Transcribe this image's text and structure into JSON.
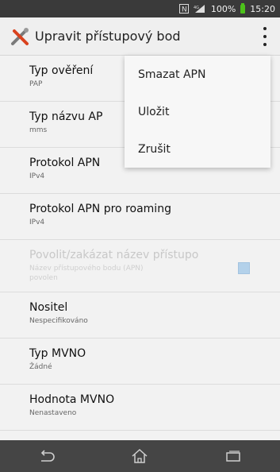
{
  "status_bar": {
    "nfc": "N",
    "signal": "4G",
    "battery": "100%",
    "time": "15:20"
  },
  "action_bar": {
    "title": "Upravit přístupový bod"
  },
  "settings": [
    {
      "title": "Typ ověření",
      "subtitle": "PAP"
    },
    {
      "title": "Typ názvu AP",
      "subtitle": "mms"
    },
    {
      "title": "Protokol APN",
      "subtitle": "IPv4"
    },
    {
      "title": "Protokol APN pro roaming",
      "subtitle": "IPv4"
    },
    {
      "title": "Povolit/zakázat název přístupo",
      "subtitle": "Název přístupového bodu (APN) povolen"
    },
    {
      "title": "Nositel",
      "subtitle": "Nespecifikováno"
    },
    {
      "title": "Typ MVNO",
      "subtitle": "Žádné"
    },
    {
      "title": "Hodnota MVNO",
      "subtitle": "Nenastaveno"
    }
  ],
  "menu": {
    "items": [
      "Smazat APN",
      "Uložit",
      "Zrušit"
    ]
  }
}
